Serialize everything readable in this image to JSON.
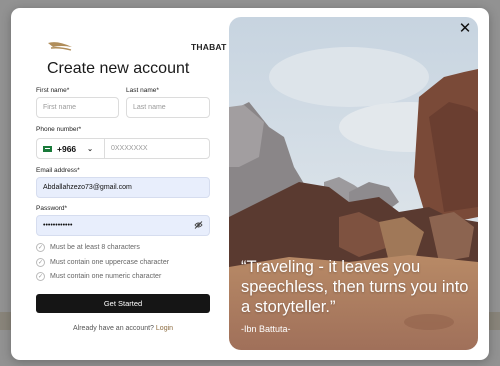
{
  "brand": {
    "name": "THABAT"
  },
  "form": {
    "title": "Create new account",
    "first_name": {
      "label": "First name*",
      "placeholder": "First name"
    },
    "last_name": {
      "label": "Last name*",
      "placeholder": "Last name"
    },
    "phone": {
      "label": "Phone number*",
      "country_code": "+966",
      "placeholder": "0XXXXXXX"
    },
    "email": {
      "label": "Email address*",
      "value": "Abdallahzezo73@gmail.com"
    },
    "password": {
      "label": "Password*",
      "value": "••••••••••••"
    },
    "rules": [
      "Must be at least 8 characters",
      "Must contain one uppercase character",
      "Must contain one numeric character"
    ],
    "submit_label": "Get Started",
    "login_prompt": "Already have an account?",
    "login_link": "Login"
  },
  "hero": {
    "quote": "“Traveling - it leaves you speechless, then turns you into a storyteller.”",
    "author": "-Ibn Battuta-"
  },
  "icons": {
    "close": "close-icon",
    "eye": "eye-off-icon",
    "chevron": "chevron-down-icon",
    "check": "check-circle-icon",
    "flag": "saudi-flag-icon"
  },
  "colors": {
    "primary_button": "#151515",
    "link": "#8b6a3e",
    "filled_input": "#e8eefc"
  }
}
